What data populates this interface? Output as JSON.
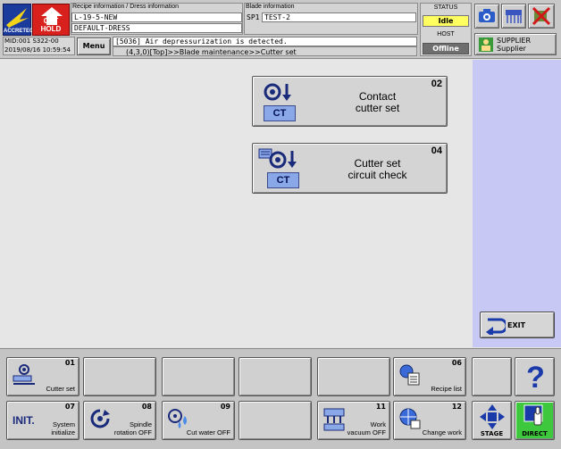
{
  "header": {
    "logos": {
      "accretech": "ACCRETECH",
      "cut_hold": "CUT HOLD"
    },
    "recipe_label": "Recipe information / Dress information",
    "recipe_value": "L-19-5-NEW",
    "dress_value": "DEFAULT-DRESS",
    "blade_label": "Blade information",
    "blade_spindle": "SP1",
    "blade_value": "TEST-2",
    "machine_id": "MID:001  S322-00",
    "datetime": "2019/08/16  10:59:54",
    "menu_label": "Menu",
    "message": "[5036] Air depressurization is detected.",
    "breadcrumb": "(4,3,0)[Top]>>Blade maintenance>>Cutter set",
    "status_label": "STATUS",
    "status_value": "Idle",
    "host_label": "HOST",
    "host_value": "Offline",
    "user_line1": "SUPPLIER",
    "user_line2": "Supplier"
  },
  "main": {
    "buttons": [
      {
        "num": "02",
        "label": "Contact\ncutter set",
        "badge": "CT"
      },
      {
        "num": "04",
        "label": "Cutter set\ncircuit check",
        "badge": "CT"
      }
    ],
    "exit_label": "EXIT"
  },
  "bottom": {
    "row1": [
      {
        "num": "01",
        "label": "Cutter set"
      },
      {
        "num": "",
        "label": ""
      },
      {
        "num": "",
        "label": ""
      },
      {
        "num": "",
        "label": ""
      },
      {
        "num": "",
        "label": ""
      },
      {
        "num": "06",
        "label": "Recipe list"
      }
    ],
    "row2": [
      {
        "num": "07",
        "label": "System\ninitialize"
      },
      {
        "num": "08",
        "label": "Spindle\nrotation OFF"
      },
      {
        "num": "09",
        "label": "Cut water OFF"
      },
      {
        "num": "",
        "label": ""
      },
      {
        "num": "11",
        "label": "Work\nvacuum OFF"
      },
      {
        "num": "12",
        "label": "Change work"
      }
    ],
    "init_text": "INIT.",
    "stage_label": "STAGE",
    "direct_label": "DIRECT",
    "help_symbol": "?"
  },
  "colors": {
    "side_panel": "#c8c8f4",
    "status_idle": "#ffff60",
    "host_offline": "#6e6e6e",
    "direct_green": "#3ec83e",
    "cut_hold_red": "#d8201c"
  }
}
